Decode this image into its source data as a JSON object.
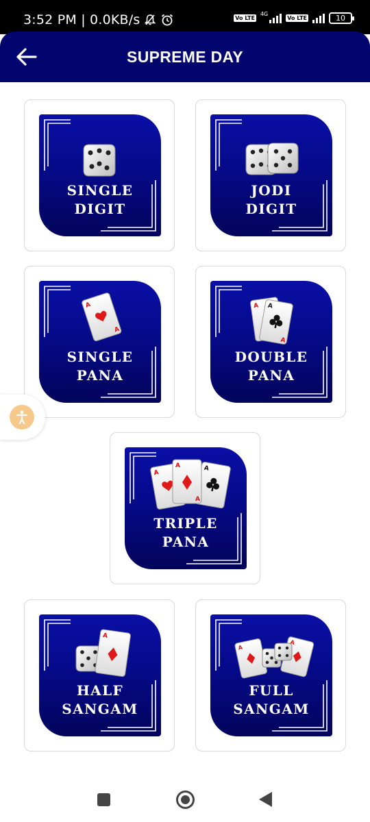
{
  "status_bar": {
    "time_and_speed": "3:52 PM | 0.0KB/s",
    "network_label": "4G",
    "volte_label": "Vo LTE",
    "battery": "10"
  },
  "header": {
    "title": "SUPREME DAY"
  },
  "games": [
    {
      "line1": "SINGLE",
      "line2": "DIGIT",
      "icon": "dice-icon"
    },
    {
      "line1": "JODI",
      "line2": "DIGIT",
      "icon": "double-dice-icon"
    },
    {
      "line1": "SINGLE",
      "line2": "PANA",
      "icon": "ace-of-hearts-card-icon"
    },
    {
      "line1": "DOUBLE",
      "line2": "PANA",
      "icon": "two-cards-icon"
    },
    {
      "line1": "TRIPLE",
      "line2": "PANA",
      "icon": "three-cards-icon"
    },
    {
      "line1": "HALF",
      "line2": "SANGAM",
      "icon": "dice-and-card-icon"
    },
    {
      "line1": "FULL",
      "line2": "SANGAM",
      "icon": "cards-and-dice-icon"
    }
  ],
  "colors": {
    "header_bg": "#03056e",
    "tile_gradient_top": "#0a0fa6",
    "tile_gradient_bottom": "#03045a",
    "accessibility_button": "#f6c98b"
  }
}
